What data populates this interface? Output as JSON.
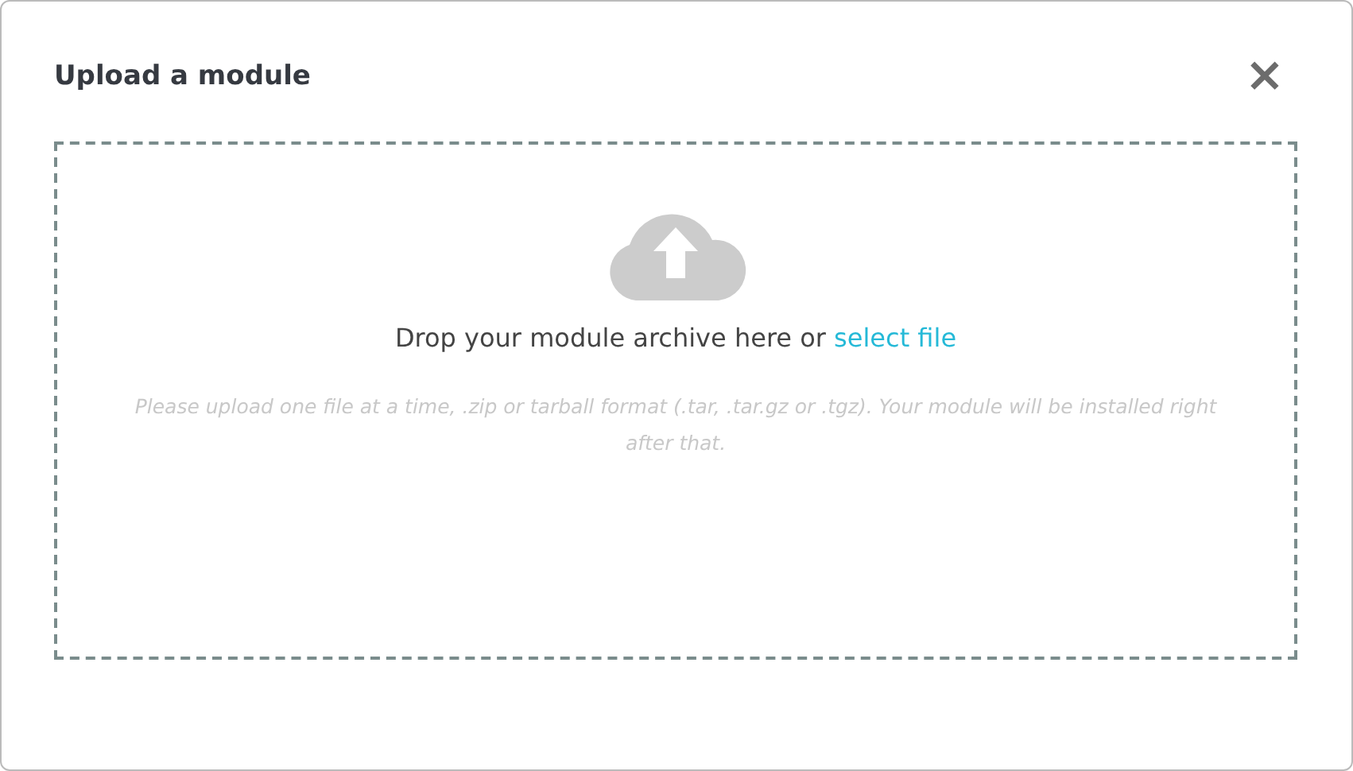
{
  "dialog": {
    "title": "Upload a module",
    "close": "×"
  },
  "drop_zone": {
    "prompt": "Drop your module archive here or",
    "link": "select file",
    "hint": "Please upload one file at a time, .zip or tarball format (.tar, .tar.gz or .tgz). Your module will be installed right after that."
  }
}
